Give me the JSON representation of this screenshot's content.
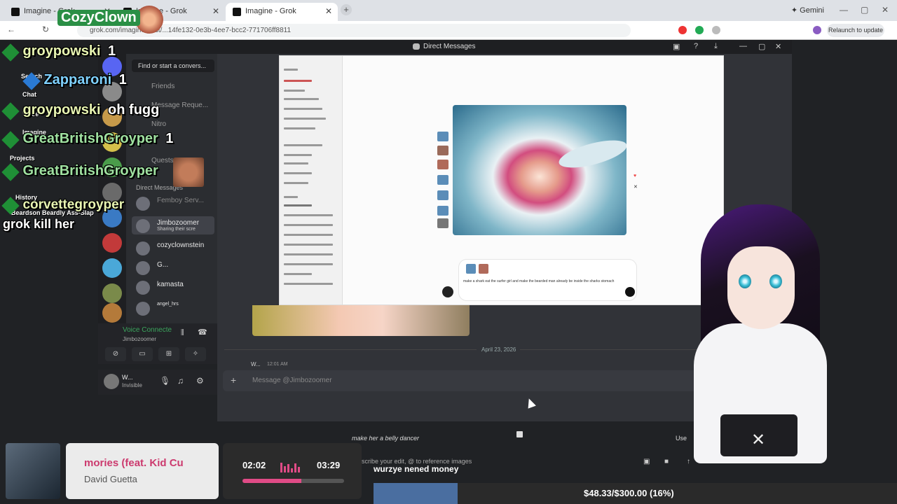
{
  "browser": {
    "tabs": [
      {
        "title": "Imagine - Grok"
      },
      {
        "title": "Imagine - Grok"
      },
      {
        "title": "Imagine - Grok"
      }
    ],
    "gemini_label": "Gemini",
    "url": "grok.com/imagine/post/...14fe132-0e3b-4ee7-bcc2-771706ff8811",
    "relaunch_label": "Relaunch to update"
  },
  "discord": {
    "window_title": "Direct Messages",
    "find_placeholder": "Find or start a convers...",
    "nav": {
      "friends": "Friends",
      "requests": "Message Reque...",
      "nitro": "Nitro",
      "quests": "Quests"
    },
    "dm_header": "Direct Messages",
    "dms": [
      {
        "name": "Femboy Serv...",
        "status": ""
      },
      {
        "name": "Jimbozoomer",
        "status": "Sharing their scre"
      },
      {
        "name": "cozyclownstein",
        "status": ""
      },
      {
        "name": "G...",
        "status": ""
      },
      {
        "name": "kamasta",
        "status": ""
      },
      {
        "name": "angel_hrs",
        "status": ""
      }
    ],
    "voice": {
      "title": "Voice Connecte",
      "channel": "Jimbozoomer"
    },
    "user": {
      "name": "W...",
      "status": "Invisible"
    },
    "date_divider": "April 23, 2026",
    "message": {
      "author": "W...",
      "time": "12:01 AM"
    },
    "message_placeholder": "Message @Jimbozoomer"
  },
  "grok_share": {
    "prompt": "make a shark eat the surfer girl and make the bearded man already be inside the sharks stomach"
  },
  "grok_edit": {
    "edit_prompt": "make her a belly dancer",
    "use_label": "Use",
    "input_hint": "scribe your edit, @ to reference images"
  },
  "stream_chat": [
    {
      "name": "groypowski",
      "msg": "1"
    },
    {
      "name": "Zapparoni",
      "msg": "1"
    },
    {
      "name": "groypowski",
      "msg": "oh fugg"
    },
    {
      "name": "GreatBritishGroyper",
      "msg": "1"
    },
    {
      "name": "GreatBritishGroyper",
      "msg": ""
    },
    {
      "name": "corvettegroyper",
      "msg": ""
    },
    {
      "name": "",
      "msg": "grok kill her"
    }
  ],
  "stream_overlay": {
    "top_name": "CozyClown",
    "side_labels": [
      "Search",
      "Chat",
      "Voice",
      "Imagine",
      "Projects",
      "History",
      "Beardson Beardly Ass-Slap"
    ],
    "caption": "wurzye nened money"
  },
  "music": {
    "song": "mories (feat. Kid Cu",
    "artist": "David Guetta",
    "elapsed": "02:02",
    "total": "03:29",
    "progress_fraction": 0.58
  },
  "goal": {
    "text": "$48.33/$300.00 (16%)",
    "fraction": 0.16
  },
  "colors": {
    "discord_bg": "#313338",
    "goal_fill": "#4a6ea0",
    "music_accent": "#e04b86"
  }
}
